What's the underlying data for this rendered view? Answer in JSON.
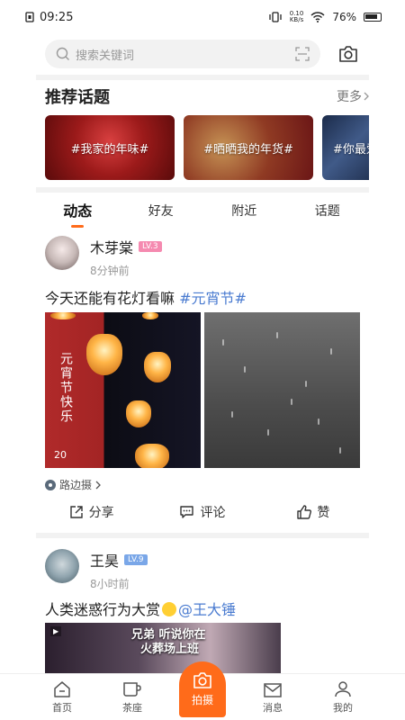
{
  "status": {
    "time": "09:25",
    "net_speed_value": "0.10",
    "net_speed_unit": "KB/s",
    "battery": "76%"
  },
  "search": {
    "placeholder": "搜索关键词"
  },
  "topics": {
    "title": "推荐话题",
    "more": "更多",
    "items": [
      {
        "label": "#我家的年味#"
      },
      {
        "label": "#晒晒我的年货#"
      },
      {
        "label": "#你最爱"
      }
    ]
  },
  "tabs": [
    "动态",
    "好友",
    "附近",
    "话题"
  ],
  "posts": [
    {
      "author": "木芽棠",
      "level": "LV.3",
      "time": "8分钟前",
      "text": "今天还能有花灯看嘛 ",
      "tag": "#元宵节#",
      "image_text": "元宵节快乐",
      "image_year": "20",
      "source": "路边摄",
      "actions": {
        "share": "分享",
        "comment": "评论",
        "like": "赞"
      }
    },
    {
      "author": "王昊",
      "level": "LV.9",
      "time": "8小时前",
      "text": "人类迷惑行为大赏",
      "mention": "@王大锤",
      "video_overlay_line1": "兄弟 听说你在",
      "video_overlay_line2": "火葬场上班"
    }
  ],
  "nav": {
    "home": "首页",
    "tea": "茶座",
    "shoot": "拍摄",
    "messages": "消息",
    "mine": "我的"
  },
  "colors": {
    "accent": "#ff6b1a",
    "tag": "#4a7bd0"
  }
}
